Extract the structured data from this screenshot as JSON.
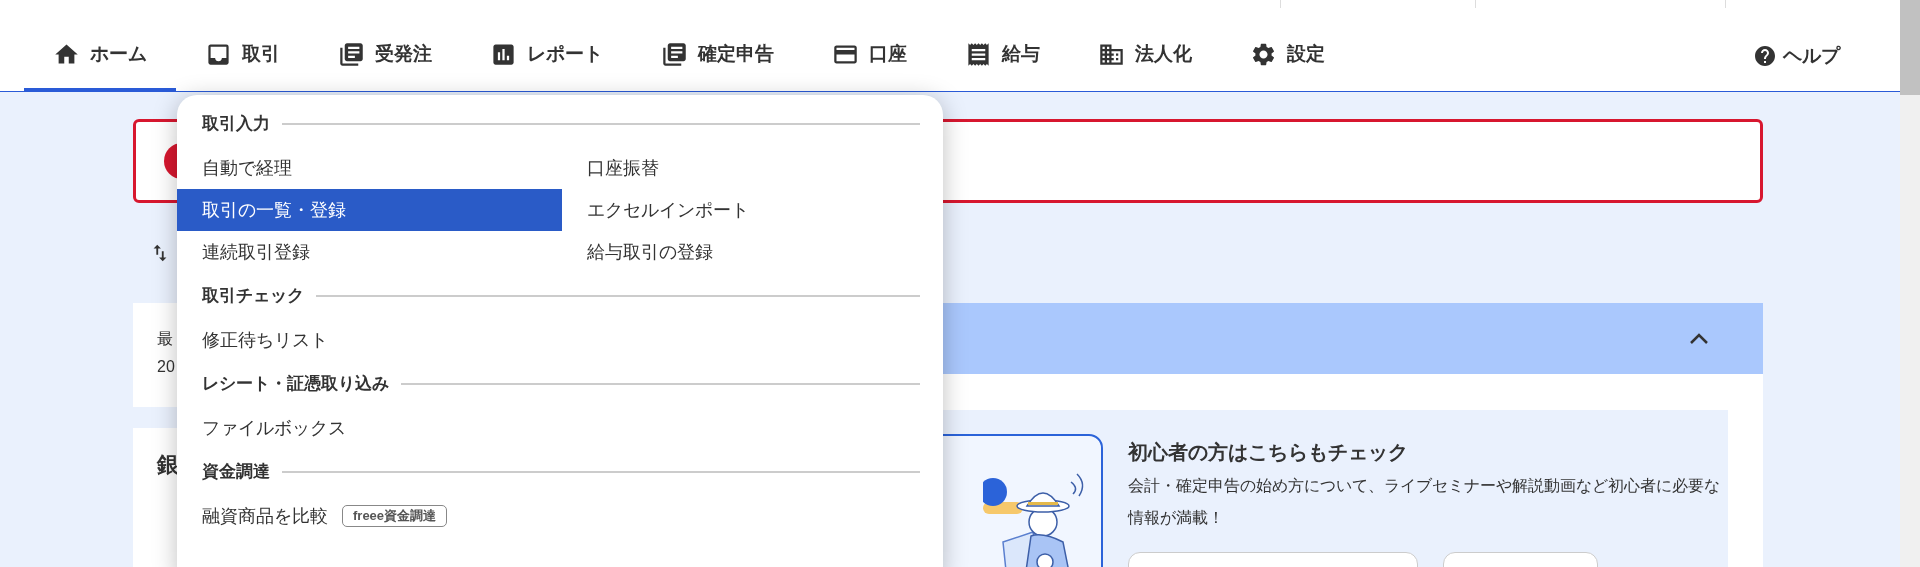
{
  "nav": {
    "items": [
      {
        "label": "ホーム",
        "selected": true
      },
      {
        "label": "取引",
        "selected": false
      },
      {
        "label": "受発注",
        "selected": false
      },
      {
        "label": "レポート",
        "selected": false
      },
      {
        "label": "確定申告",
        "selected": false
      },
      {
        "label": "口座",
        "selected": false
      },
      {
        "label": "給与",
        "selected": false
      },
      {
        "label": "法人化",
        "selected": false
      },
      {
        "label": "設定",
        "selected": false
      }
    ],
    "help": "ヘルプ"
  },
  "dropdown": {
    "sections": [
      {
        "title": "取引入力",
        "items": [
          {
            "label": "自動で経理",
            "selected": false
          },
          {
            "label": "口座振替",
            "selected": false
          },
          {
            "label": "取引の一覧・登録",
            "selected": true
          },
          {
            "label": "エクセルインポート",
            "selected": false
          },
          {
            "label": "連続取引登録",
            "selected": false
          },
          {
            "label": "給与取引の登録",
            "selected": false
          }
        ]
      },
      {
        "title": "取引チェック",
        "items": [
          {
            "label": "修正待ちリスト",
            "selected": false
          }
        ]
      },
      {
        "title": "レシート・証憑取り込み",
        "items": [
          {
            "label": "ファイルボックス",
            "selected": false
          }
        ]
      },
      {
        "title": "資金調達",
        "items": [
          {
            "label": "融資商品を比較",
            "selected": false,
            "badge": "freee資金調達"
          }
        ]
      }
    ]
  },
  "summary": {
    "line_1": "最",
    "line_2": "20"
  },
  "bank_card": {
    "title": "銀"
  },
  "beginner": {
    "title": "初心者の方はこちらもチェック",
    "text": "会計・確定申告の始め方について、ライブセミナーや解説動画など初心者に必要な情報が満載！"
  }
}
